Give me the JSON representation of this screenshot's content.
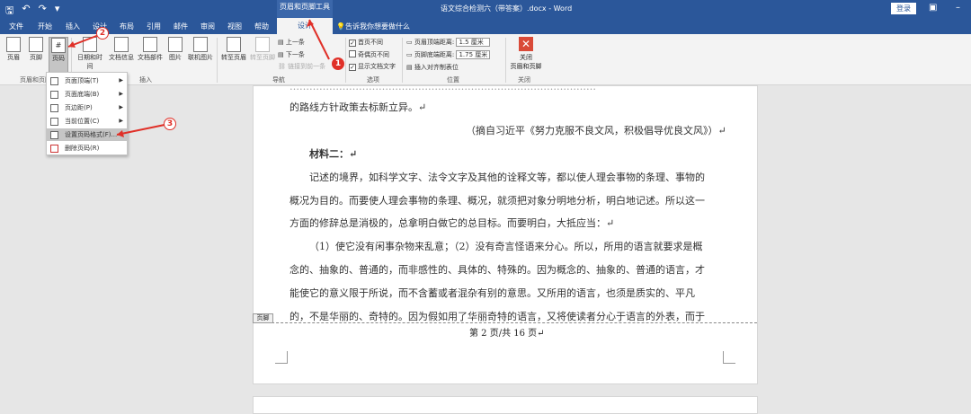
{
  "titlebar": {
    "context_tools": "页眉和页脚工具",
    "doc_title": "语文综合检测六（带答案）.docx - Word",
    "login": "登录"
  },
  "tabs": [
    "文件",
    "开始",
    "插入",
    "设计",
    "布局",
    "引用",
    "邮件",
    "审阅",
    "视图",
    "帮助"
  ],
  "active_tab": "设计",
  "tell_me": "告诉我你想要做什么",
  "ribbon": {
    "header": "页眉",
    "footer": "页脚",
    "page_number": "页码",
    "datetime": "日期和时间",
    "docinfo": "文档信息",
    "docparts": "文档部件",
    "picture": "图片",
    "online_picture": "联机图片",
    "goto_header": "转至页眉",
    "goto_footer": "转至页脚",
    "prev": "上一条",
    "next": "下一条",
    "link_prev": "链接到前一条",
    "group_hf": "页眉和页脚",
    "group_insert": "插入",
    "group_nav": "导航",
    "opt_first": "首页不同",
    "opt_odd": "奇偶页不同",
    "opt_show": "显示文档文字",
    "group_options": "选项",
    "header_dist_label": "页眉顶端距离:",
    "header_dist": "1.5 厘米",
    "footer_dist_label": "页脚底端距离:",
    "footer_dist": "1.75 厘米",
    "insert_align": "插入对齐制表位",
    "group_position": "位置",
    "close_label": "关闭\n页眉和页脚",
    "group_close": "关闭"
  },
  "menu": [
    {
      "label": "页面顶端(T)",
      "arrow": true
    },
    {
      "label": "页面底端(B)",
      "arrow": true
    },
    {
      "label": "页边距(P)",
      "arrow": true
    },
    {
      "label": "当前位置(C)",
      "arrow": true
    },
    {
      "label": "设置页码格式(F)...",
      "arrow": false
    },
    {
      "label": "删除页码(R)",
      "arrow": false
    }
  ],
  "document": {
    "lines": [
      "…………………………………………………………………………………",
      "的路线方针政策去标新立异。↵",
      "（摘自习近平《努力克服不良文风，积极倡导优良文风》）↵",
      "材料二：↵",
      "记述的境界，如科学文字、法令文字及其他的诠释文等，都以使人理会事物的条理、事物的",
      "概况为目的。而要使人理会事物的条理、概况，就须把对象分明地分析，明白地记述。所以这一",
      "方面的修辞总是消极的，总拿明白做它的总目标。而要明白，大抵应当：↵",
      "（1）使它没有闲事杂物来乱意；（2）没有奇言怪语来分心。所以，所用的语言就要求是概",
      "念的、抽象的、普通的，而非感性的、具体的、特殊的。因为概念的、抽象的、普通的语言，才",
      "能使它的意义限于所说，而不含蓄或者混杂有别的意思。又所用的语言，也须是质实的、平凡",
      "的，不是华丽的、奇特的。因为假如用了华丽奇特的语言，又将使读者分心于语言的外表，而于"
    ],
    "footer_tag": "页脚",
    "page_number": "第 2 页/共 16 页↵"
  },
  "annotations": [
    "1",
    "2",
    "3"
  ],
  "colors": {
    "accent": "#2b579a",
    "annotation": "#e03028"
  }
}
